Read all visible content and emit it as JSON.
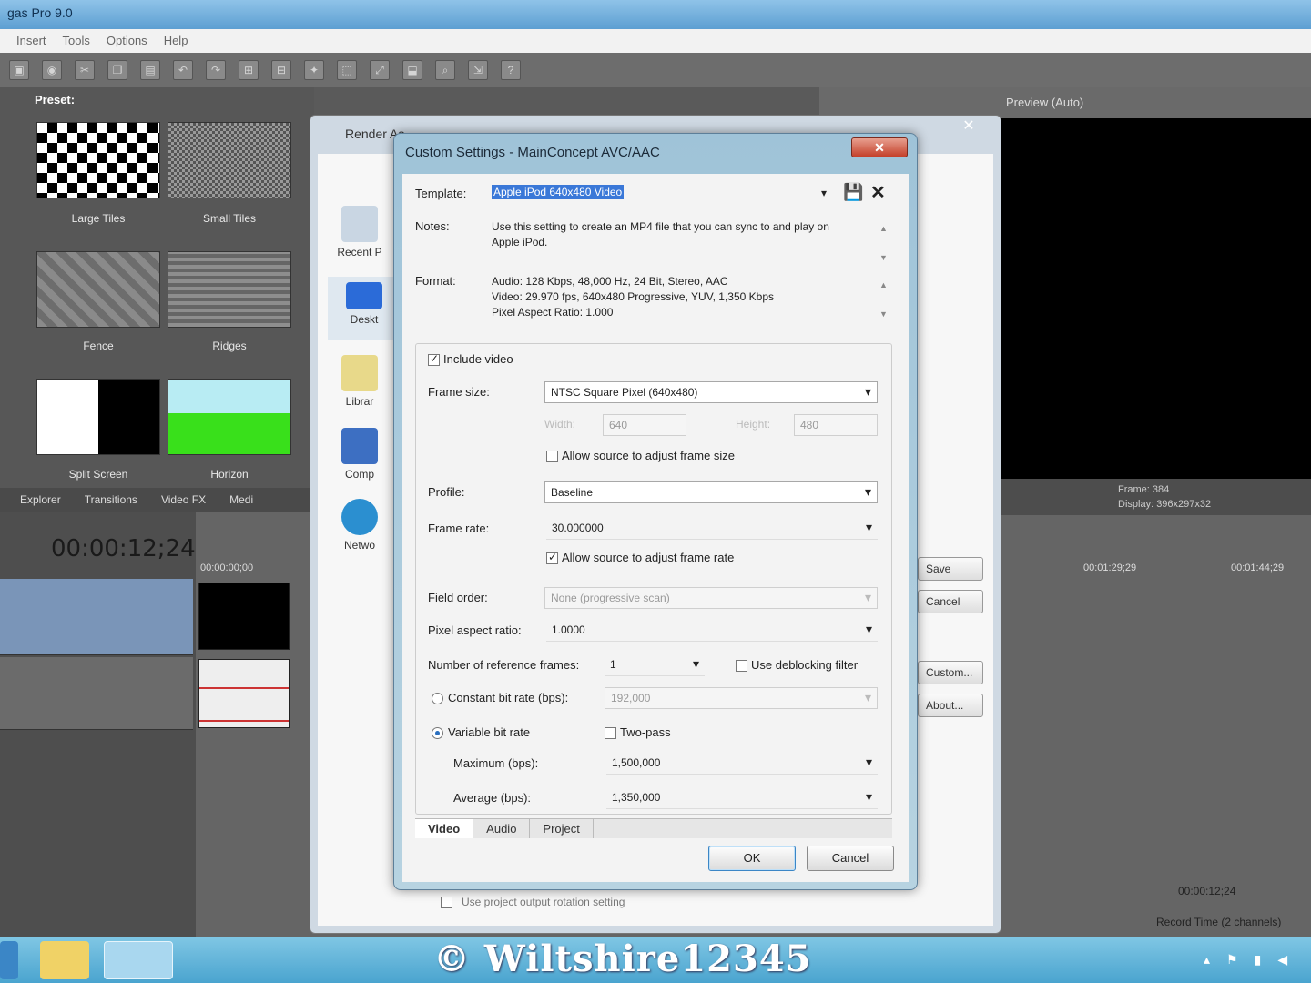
{
  "app": {
    "title": "gas Pro 9.0",
    "menu": [
      "Insert",
      "Tools",
      "Options",
      "Help"
    ]
  },
  "preset_panel": {
    "label": "Preset:",
    "items": [
      "Large Tiles",
      "Small Tiles",
      "Fence",
      "Ridges",
      "Split Screen",
      "Horizon"
    ]
  },
  "window_tabs": [
    "Explorer",
    "Transitions",
    "Video FX",
    "Medi"
  ],
  "timeline": {
    "timecode": "00:00:12;24",
    "ruler_start": "00:00:00;00",
    "marks": [
      "00:01:29;29",
      "00:01:44;29"
    ],
    "status_time": "00:00:12;24",
    "record_time": "Record Time (2 channels)"
  },
  "preview": {
    "label": "Preview (Auto)",
    "frame_label": "Frame:",
    "frame_value": "384",
    "display_label": "Display:",
    "display_value": "396x297x32"
  },
  "render_dialog": {
    "title": "Render As",
    "sidebar": [
      "Recent P",
      "Deskt",
      "Librar",
      "Comp",
      "Netwo"
    ],
    "buttons": [
      "Save",
      "Cancel",
      "Custom...",
      "About..."
    ],
    "bottom_checkbox": "Use project output rotation setting"
  },
  "custom_settings": {
    "title": "Custom Settings - MainConcept AVC/AAC",
    "template_label": "Template:",
    "template_value": "Apple iPod 640x480 Video",
    "notes_label": "Notes:",
    "notes_text": "Use this setting to create an MP4 file that you can sync to and play on Apple iPod.",
    "format_label": "Format:",
    "format_lines": [
      "Audio: 128 Kbps, 48,000 Hz, 24 Bit, Stereo, AAC",
      "Video: 29.970 fps, 640x480 Progressive, YUV, 1,350 Kbps",
      "Pixel Aspect Ratio: 1.000"
    ],
    "include_video": "Include video",
    "frame_size_label": "Frame size:",
    "frame_size_value": "NTSC Square Pixel (640x480)",
    "width_label": "Width:",
    "width_value": "640",
    "height_label": "Height:",
    "height_value": "480",
    "allow_frame_size": "Allow source to adjust frame size",
    "profile_label": "Profile:",
    "profile_value": "Baseline",
    "frame_rate_label": "Frame rate:",
    "frame_rate_value": "30.000000",
    "allow_frame_rate": "Allow source to adjust frame rate",
    "field_order_label": "Field order:",
    "field_order_value": "None (progressive scan)",
    "pixel_aspect_label": "Pixel aspect ratio:",
    "pixel_aspect_value": "1.0000",
    "ref_frames_label": "Number of reference frames:",
    "ref_frames_value": "1",
    "deblocking_label": "Use deblocking filter",
    "constant_bitrate_label": "Constant bit rate (bps):",
    "constant_bitrate_value": "192,000",
    "variable_bitrate_label": "Variable bit rate",
    "two_pass_label": "Two-pass",
    "maximum_label": "Maximum (bps):",
    "maximum_value": "1,500,000",
    "average_label": "Average (bps):",
    "average_value": "1,350,000",
    "tabs": [
      "Video",
      "Audio",
      "Project"
    ],
    "ok_label": "OK",
    "cancel_label": "Cancel"
  },
  "taskbar": {
    "watermark": "© Wiltshire12345"
  }
}
